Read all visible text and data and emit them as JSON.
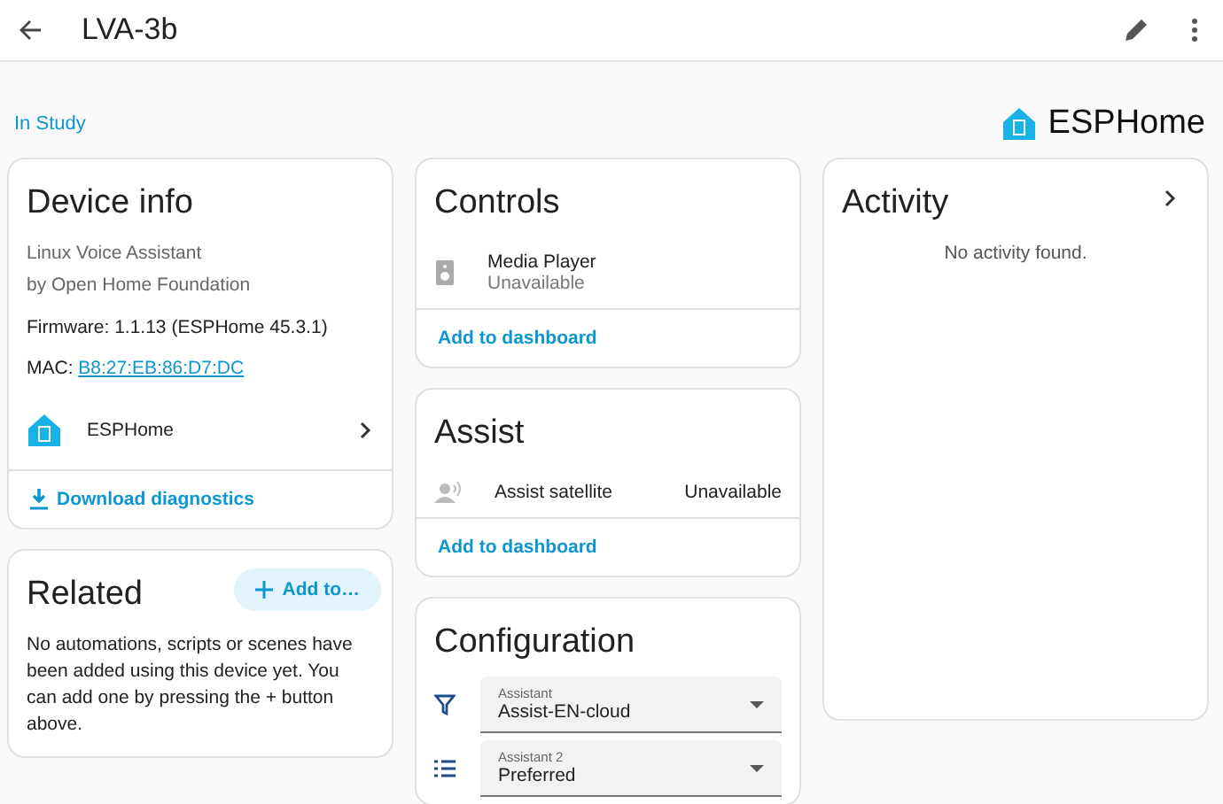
{
  "header": {
    "title": "LVA-3b"
  },
  "area_link": "In Study",
  "brand": "ESPHome",
  "device_info": {
    "title": "Device info",
    "model": "Linux Voice Assistant",
    "manufacturer": "by Open Home Foundation",
    "firmware": "Firmware: 1.1.13 (ESPHome 45.3.1)",
    "mac_label": "MAC:",
    "mac_value": "B8:27:EB:86:D7:DC",
    "integration": "ESPHome",
    "action": "Download diagnostics"
  },
  "related": {
    "title": "Related",
    "button": "Add to…",
    "text": "No automations, scripts or scenes have been added using this device yet. You can add one by pressing the + button above."
  },
  "controls": {
    "title": "Controls",
    "entities": [
      {
        "kind": "speaker",
        "name": "Media Player",
        "state": "Unavailable"
      }
    ],
    "action": "Add to dashboard"
  },
  "assist": {
    "title": "Assist",
    "entities": [
      {
        "kind": "satellite",
        "name": "Assist satellite",
        "state": "Unavailable"
      }
    ],
    "action": "Add to dashboard"
  },
  "configuration": {
    "title": "Configuration",
    "selects": [
      {
        "kind": "filter",
        "label": "Assistant",
        "value": "Assist-EN-cloud"
      },
      {
        "kind": "list",
        "label": "Assistant 2",
        "value": "Preferred"
      }
    ]
  },
  "activity": {
    "title": "Activity",
    "empty": "No activity found."
  }
}
